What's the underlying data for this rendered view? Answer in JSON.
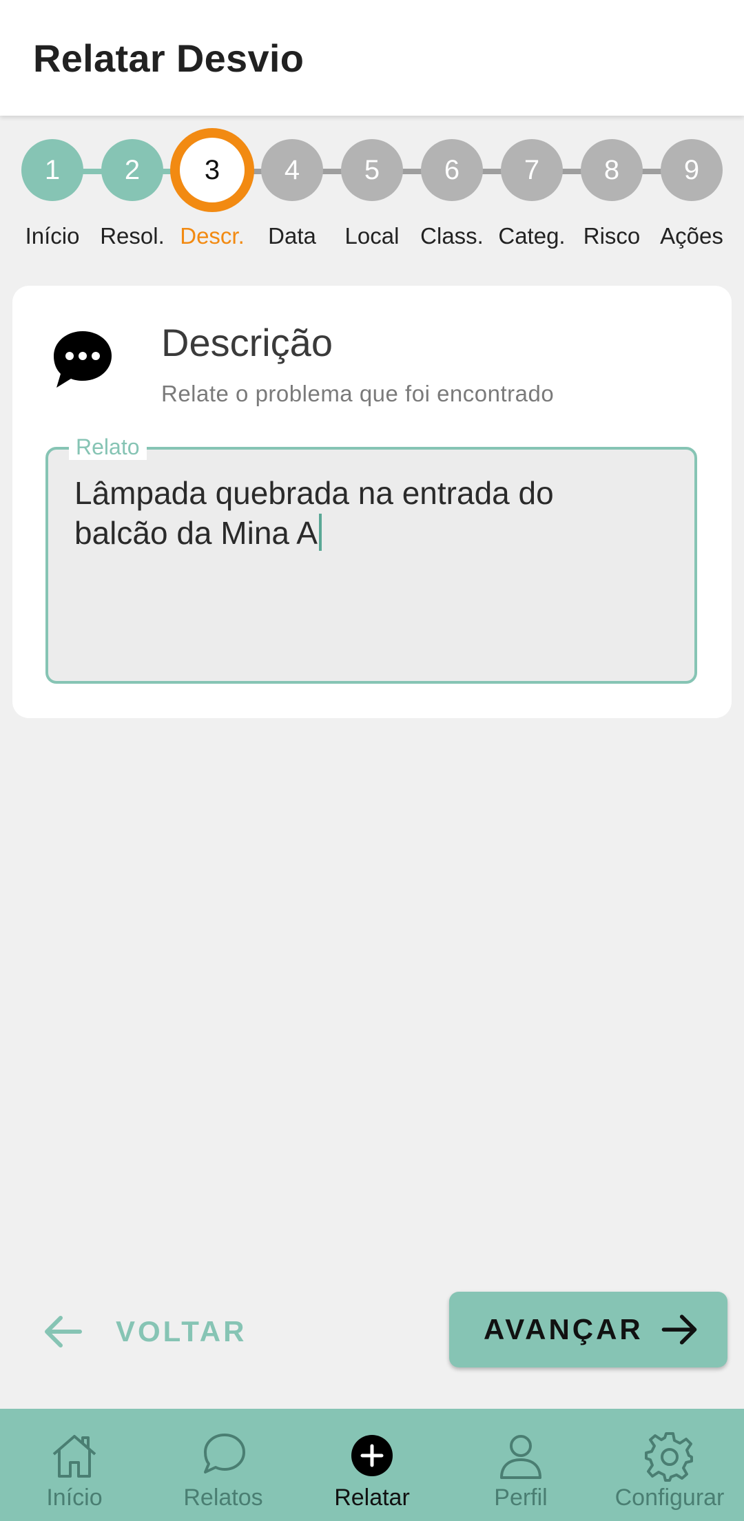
{
  "header": {
    "title": "Relatar Desvio"
  },
  "stepper": {
    "current_index": 2,
    "steps": [
      {
        "number": "1",
        "label": "Início",
        "state": "done"
      },
      {
        "number": "2",
        "label": "Resol.",
        "state": "done"
      },
      {
        "number": "3",
        "label": "Descr.",
        "state": "current"
      },
      {
        "number": "4",
        "label": "Data",
        "state": "pending"
      },
      {
        "number": "5",
        "label": "Local",
        "state": "pending"
      },
      {
        "number": "6",
        "label": "Class.",
        "state": "pending"
      },
      {
        "number": "7",
        "label": "Categ.",
        "state": "pending"
      },
      {
        "number": "8",
        "label": "Risco",
        "state": "pending"
      },
      {
        "number": "9",
        "label": "Ações",
        "state": "pending"
      }
    ]
  },
  "card": {
    "icon": "chat-bubble-dots-icon",
    "title": "Descrição",
    "subtitle": "Relate o problema que foi encontrado",
    "field": {
      "label": "Relato",
      "value_line1": "Lâmpada quebrada na entrada do",
      "value_line2": "balcão da Mina A"
    }
  },
  "actions": {
    "back_label": "VOLTAR",
    "back_icon": "arrow-left-icon",
    "next_label": "AVANÇAR",
    "next_icon": "arrow-right-icon"
  },
  "bottom_nav": {
    "items": [
      {
        "label": "Início",
        "icon": "home-icon"
      },
      {
        "label": "Relatos",
        "icon": "chat-icon"
      },
      {
        "label": "Relatar",
        "icon": "add-circle-icon",
        "active": true
      },
      {
        "label": "Perfil",
        "icon": "person-icon"
      },
      {
        "label": "Configurar",
        "icon": "gear-icon"
      }
    ]
  },
  "colors": {
    "accent": "#86c4b4",
    "current_step": "#f28a12",
    "pending_step": "#b3b3b3",
    "background": "#f0f0f0"
  }
}
